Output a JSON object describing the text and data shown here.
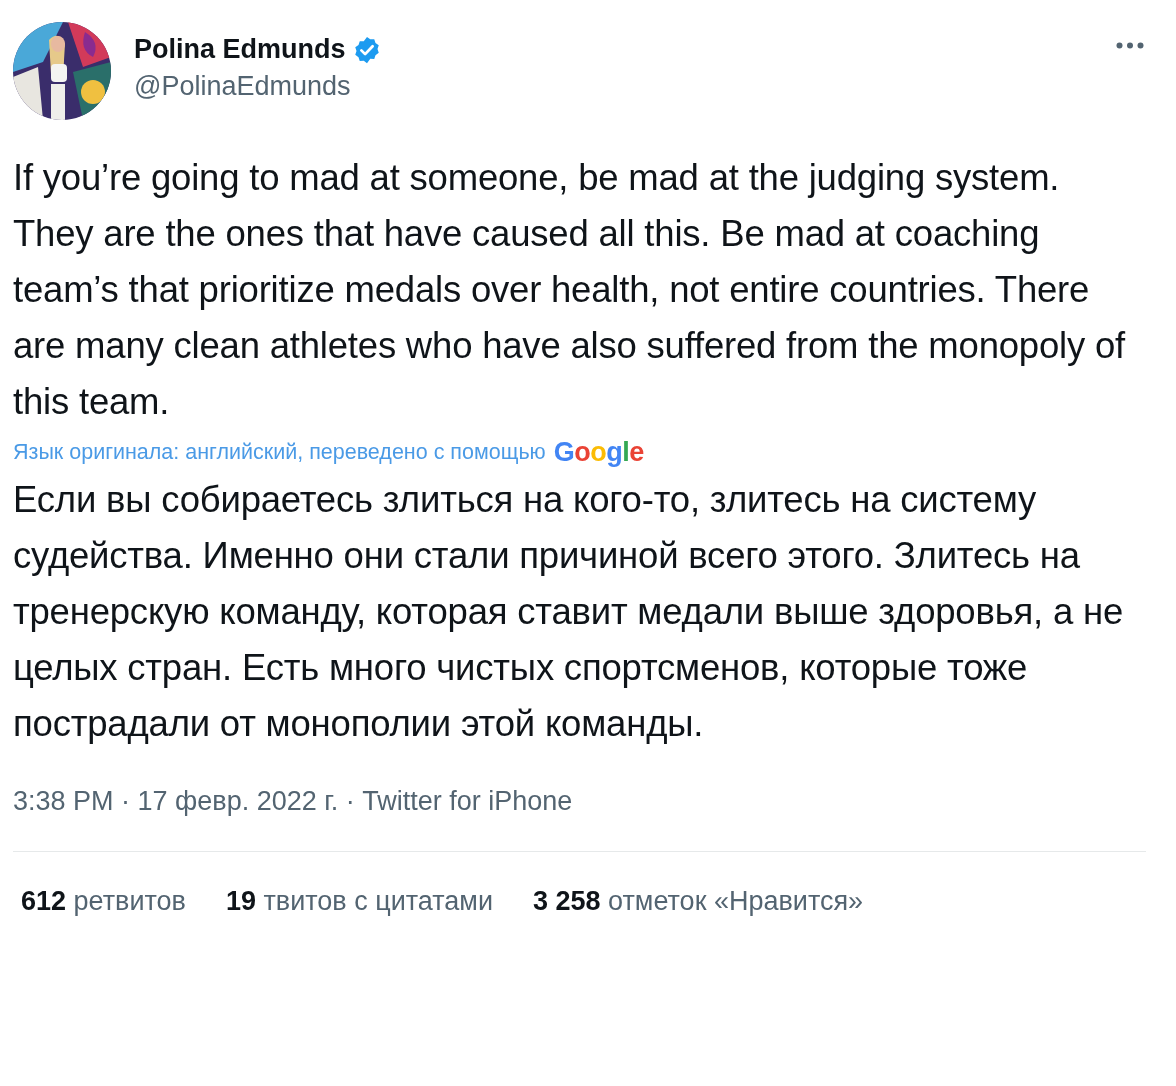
{
  "author": {
    "name": "Polina Edmunds",
    "verified": true,
    "handle": "@PolinaEdmunds"
  },
  "tweet_text": "If you’re going to mad at someone, be mad at the judging system. They are the ones that have caused all this. Be mad at coaching team’s that prioritize medals over health, not entire countries. There are many clean athletes who have also suffered from the monopoly of this team.",
  "translation": {
    "note": "Язык оригинала: английский, переведено с помощью",
    "provider": "Google",
    "text": "Если вы собираетесь злиться на кого-то, злитесь на систему судейства. Именно они стали причиной всего этого. Злитесь на тренерскую команду, которая ставит медали выше здоровья, а не целых стран. Есть много чистых спортсменов, которые тоже пострадали от монополии этой команды."
  },
  "timestamp": "3:38 PM · 17 февр. 2022 г. · Twitter for iPhone",
  "stats": [
    {
      "count": "612",
      "label": "ретвитов"
    },
    {
      "count": "19",
      "label": "твитов с цитатами"
    },
    {
      "count": "3 258",
      "label": "отметок «Нравится»"
    }
  ]
}
